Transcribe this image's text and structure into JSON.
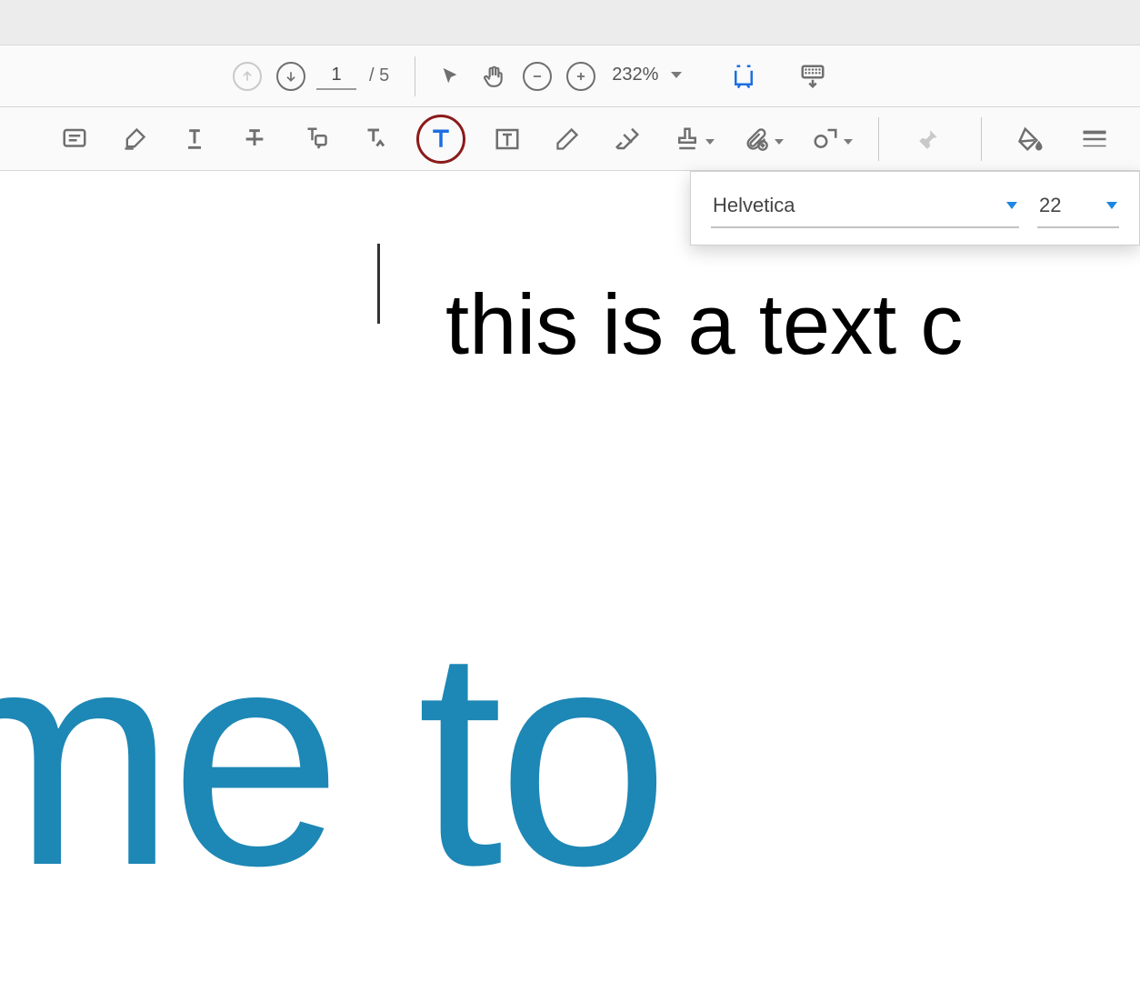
{
  "pages": {
    "current": "1",
    "separator": "/",
    "total": "5"
  },
  "zoom": {
    "value": "232%"
  },
  "font_panel": {
    "font": "Helvetica",
    "size": "22"
  },
  "canvas": {
    "typed_text": "this is a text c",
    "bg_text": "me to"
  }
}
